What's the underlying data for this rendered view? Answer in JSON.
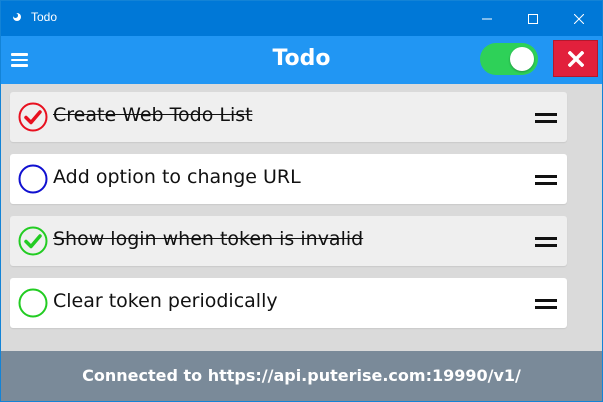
{
  "window": {
    "title": "Todo"
  },
  "header": {
    "title": "Todo",
    "toggle_on": true
  },
  "todos": [
    {
      "text": "Create Web Todo List",
      "done": true,
      "color": "#e8101f"
    },
    {
      "text": "Add option to change URL",
      "done": false,
      "color": "#1010d0"
    },
    {
      "text": "Show login when token is invalid",
      "done": true,
      "color": "#22cc22"
    },
    {
      "text": "Clear token periodically",
      "done": false,
      "color": "#22cc22"
    }
  ],
  "footer": {
    "status": "Connected to https://api.puterise.com:19990/v1/"
  },
  "colors": {
    "titlebar": "#0078d7",
    "header": "#2196f3",
    "toggle": "#2ed158",
    "close_button": "#e2203c",
    "footer": "#7a8a99"
  },
  "icons": {
    "menu": "hamburger-icon",
    "close_app": "close-icon",
    "drag": "drag-handle-icon"
  }
}
